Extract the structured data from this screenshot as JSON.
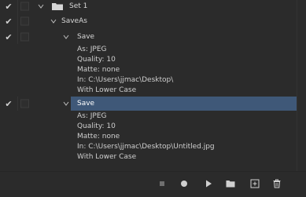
{
  "actions": {
    "set": {
      "label": "Set 1",
      "enabled": true
    },
    "action": {
      "label": "SaveAs",
      "enabled": true
    },
    "commands": [
      {
        "label": "Save",
        "enabled": true,
        "selected": false,
        "details": {
          "as": "As: JPEG",
          "quality": "Quality: 10",
          "matte": "Matte: none",
          "in": "In: C:\\Users\\jjmac\\Desktop\\",
          "case": "With Lower Case"
        }
      },
      {
        "label": "Save",
        "enabled": true,
        "selected": true,
        "details": {
          "as": "As: JPEG",
          "quality": "Quality: 10",
          "matte": "Matte: none",
          "in": "In: C:\\Users\\jjmac\\Desktop\\Untitled.jpg",
          "case": "With Lower Case"
        }
      }
    ]
  },
  "toolbar": {
    "buttons": [
      "stop-icon",
      "record-icon",
      "play-icon",
      "new-set-icon",
      "new-action-icon",
      "delete-icon"
    ]
  },
  "colors": {
    "background": "#2b2b2b",
    "selection": "#3f5878",
    "text": "#d6d6d6"
  }
}
